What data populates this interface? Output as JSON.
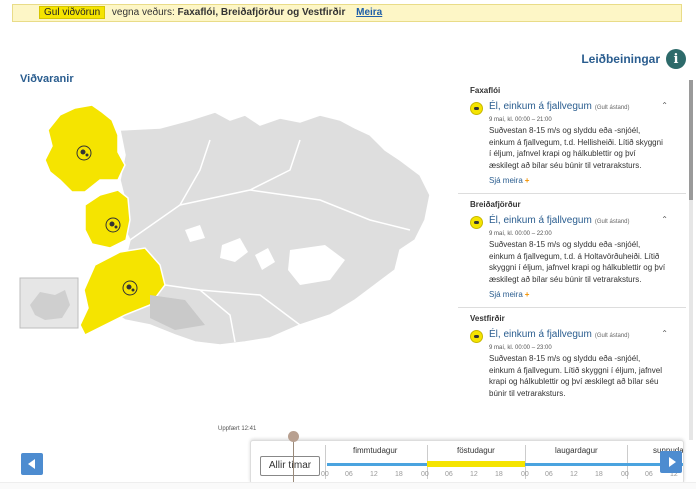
{
  "banner": {
    "badge": "Gul viðvörun",
    "prefix": "vegna veðurs:",
    "regions": "Faxaflói, Breiðafjörður og Vestfirðir",
    "link": "Meira"
  },
  "help": {
    "label": "Leiðbeiningar",
    "icon": "info-icon"
  },
  "map": {
    "title": "Viðvaranir",
    "updated": "Uppfært 12:41",
    "warn_color": "#f5e400"
  },
  "warnings": [
    {
      "region": "Faxaflói",
      "title": "Él, einkum á fjallvegum",
      "state": "(Gult ástand)",
      "time": "9 maí, kl. 00:00 – 21:00",
      "text": "Suðvestan 8-15 m/s og slyddu eða -snjóél, einkum á fjallvegum, t.d. Hellisheiði. Lítið skyggni í éljum, jafnvel krapi og hálkublettir og því æskilegt að bílar séu búnir til vetraraksturs.",
      "more": "Sjá meira"
    },
    {
      "region": "Breiðafjörður",
      "title": "Él, einkum á fjallvegum",
      "state": "(Gult ástand)",
      "time": "9 maí, kl. 00:00 – 22:00",
      "text": "Suðvestan 8-15 m/s og slyddu eða -snjóél, einkum á fjallvegum, t.d. á Holtavörðuheiði. Lítið skyggni í éljum, jafnvel krapi og hálkublettir og því æskilegt að bílar séu búnir til vetraraksturs.",
      "more": "Sjá meira"
    },
    {
      "region": "Vestfirðir",
      "title": "Él, einkum á fjallvegum",
      "state": "(Gult ástand)",
      "time": "9 maí, kl. 00:00 – 23:00",
      "text": "Suðvestan 8-15 m/s og slyddu eða -snjóél, einkum á fjallvegum. Lítið skyggni í éljum, jafnvel krapi og hálkublettir og því æskilegt að bílar séu búnir til vetraraksturs.",
      "more": ""
    }
  ],
  "timeline": {
    "all_times": "Allir tímar",
    "days": [
      "fimmtudagur",
      "föstudagur",
      "laugardagur",
      "sunnuda"
    ],
    "hours": [
      "00",
      "06",
      "12",
      "18",
      "00",
      "06",
      "12",
      "18",
      "00",
      "06",
      "12",
      "18",
      "00",
      "06",
      "12"
    ]
  }
}
